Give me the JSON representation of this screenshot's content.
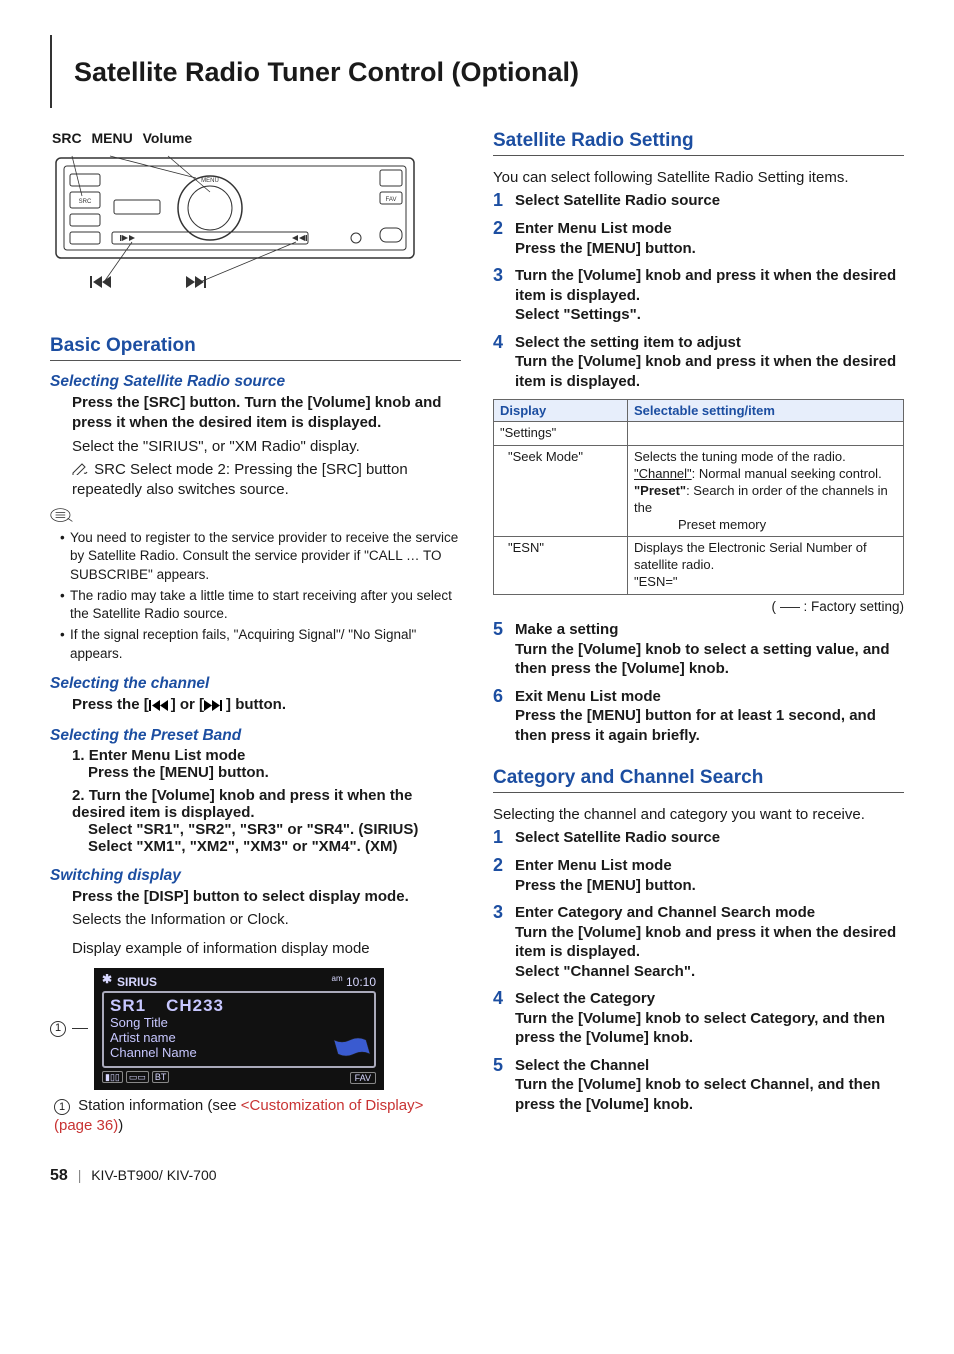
{
  "page": {
    "title": "Satellite Radio Tuner Control (Optional)",
    "number": "58",
    "model": "KIV-BT900/ KIV-700"
  },
  "left": {
    "control_labels": {
      "a": "SRC",
      "b": "MENU",
      "c": "Volume"
    },
    "h2": "Basic Operation",
    "sel_source": {
      "h3": "Selecting Satellite Radio source",
      "p1": "Press the [SRC] button. Turn the [Volume] knob and press it when the desired item is displayed.",
      "p2": "Select the \"SIRIUS\", or \"XM Radio\" display.",
      "p3": "SRC Select mode 2: Pressing the [SRC] button repeatedly also switches source.",
      "notes": [
        "You need to register to the service provider to receive the service by Satellite Radio. Consult the service provider if \"CALL … TO SUBSCRIBE\" appears.",
        "The radio may take a little time to start receiving after you select the Satellite Radio source.",
        "If the signal reception fails, \"Acquiring Signal\"/ \"No Signal\" appears."
      ]
    },
    "sel_channel": {
      "h3": "Selecting the channel",
      "p_pre": "Press the [",
      "p_mid": "] or [",
      "p_post": "] button."
    },
    "sel_preset": {
      "h3": "Selecting the Preset Band",
      "s1n": "1.",
      "s1h": "Enter Menu List mode",
      "s1b": "Press the [MENU] button.",
      "s2n": "2.",
      "s2h": "Turn the [Volume] knob and press it when the desired item is displayed.",
      "s2b1": "Select \"SR1\", \"SR2\", \"SR3\" or \"SR4\". (SIRIUS)",
      "s2b2": "Select \"XM1\", \"XM2\", \"XM3\" or \"XM4\". (XM)"
    },
    "switch_disp": {
      "h3": "Switching display",
      "p1": "Press the [DISP] button to select display mode.",
      "p2": "Selects the Information or Clock.",
      "p3": "Display example of information display mode"
    },
    "display": {
      "brand": "SIRIUS",
      "time_ampm": "am",
      "time": "10:10",
      "band": "SR1",
      "channel": "CH233",
      "line1": "Song Title",
      "line2": "Artist name",
      "line3": "Channel Name",
      "fav": "FAV",
      "bt": "BT"
    },
    "callout": {
      "num": "1",
      "text_a": "Station information (see ",
      "link": "<Customization of Display> (page 36)",
      "text_b": ")"
    }
  },
  "right": {
    "srs": {
      "h2": "Satellite Radio Setting",
      "intro": "You can select following Satellite Radio Setting items.",
      "steps": {
        "s1": "Select Satellite Radio source",
        "s2h": "Enter Menu List mode",
        "s2b": "Press the [MENU] button.",
        "s3h": "Turn the [Volume] knob and press it when the desired item is displayed.",
        "s3b": "Select \"Settings\".",
        "s4h": "Select the setting item to adjust",
        "s4b": "Turn the [Volume] knob and press it when the desired item is displayed.",
        "s5h": "Make a setting",
        "s5b": "Turn the [Volume] knob to select a setting value, and then press the [Volume] knob.",
        "s6h": "Exit Menu List mode",
        "s6b": "Press the [MENU] button for at least 1 second, and then press it again briefly."
      },
      "table": {
        "th1": "Display",
        "th2": "Selectable setting/item",
        "r1": "\"Settings\"",
        "r2d": "\"Seek Mode\"",
        "r2a": "Selects the tuning mode of the radio.",
        "r2b_u": "\"Channel\"",
        "r2b_rest": ": Normal manual seeking control.",
        "r2c_b": "\"Preset\"",
        "r2c_rest": ": Search in order of the channels in the",
        "r2d2": "Preset memory",
        "r3d": "\"ESN\"",
        "r3a": "Displays the Electronic Serial Number of satellite radio.",
        "r3b": "\"ESN=\""
      },
      "factory": "(      : Factory setting)"
    },
    "ccs": {
      "h2": "Category and Channel Search",
      "intro": "Selecting the channel and category you want to receive.",
      "steps": {
        "s1": "Select Satellite Radio source",
        "s2h": "Enter Menu List mode",
        "s2b": "Press the [MENU] button.",
        "s3h": "Enter Category and Channel Search mode",
        "s3b1": "Turn the [Volume] knob and press it when the desired item is displayed.",
        "s3b2": "Select \"Channel Search\".",
        "s4h": "Select the Category",
        "s4b": "Turn the [Volume] knob to select Category, and then press the [Volume] knob.",
        "s5h": "Select the Channel",
        "s5b": "Turn the [Volume] knob to select Channel, and then press the [Volume] knob."
      }
    }
  }
}
